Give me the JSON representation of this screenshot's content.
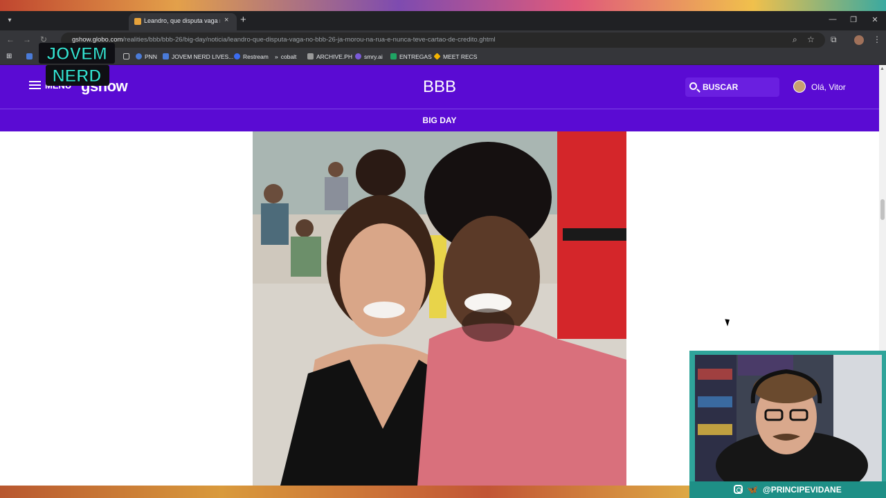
{
  "browser": {
    "tab": {
      "title": "Leandro, que disputa vaga no B",
      "close": "×"
    },
    "new_tab": "+",
    "window_buttons": {
      "minimize": "—",
      "restore": "❐",
      "close": "✕"
    },
    "url": {
      "domain": "gshow.globo.com",
      "path": "/realities/bbb/bbb-26/big-day/noticia/leandro-que-disputa-vaga-no-bbb-26-ja-morou-na-rua-e-nunca-teve-cartao-de-credito.ghtml"
    },
    "bookmarks": [
      {
        "label": "",
        "icon": "folder-icon",
        "color": "#c8c8c8"
      },
      {
        "label": "PNN",
        "icon": "globe-icon",
        "color": "#4a7bd8"
      },
      {
        "label": "JOVEM NERD LIVES...",
        "icon": "doc-icon",
        "color": "#4a7bd8"
      },
      {
        "label": "Restream",
        "icon": "restream-icon",
        "color": "#3b6cf0"
      },
      {
        "label": "cobalt",
        "icon": "chevrons-icon",
        "color": "#c8c8c8"
      },
      {
        "label": "ARCHIVE.PH",
        "icon": "archive-icon",
        "color": "#9a9a9a"
      },
      {
        "label": "smry.ai",
        "icon": "smry-icon",
        "color": "#7a5ad8"
      },
      {
        "label": "ENTREGAS",
        "icon": "sheet-icon",
        "color": "#1fa463"
      },
      {
        "label": "MEET RECS",
        "icon": "drive-icon",
        "color": "#f4b400"
      }
    ]
  },
  "site": {
    "menu_label": "MENU",
    "logo": "gshow",
    "section_title": "BBB",
    "search_label": "BUSCAR",
    "user_greeting": "Olá, Vitor",
    "subnav": "BIG DAY",
    "brand_color": "#5a0bd3"
  },
  "overlay": {
    "logo_text_1": "JOVEM",
    "logo_text_2": "NERD",
    "handle": "@PRINCIPEVIDANE",
    "accent": "#2fa49a"
  }
}
